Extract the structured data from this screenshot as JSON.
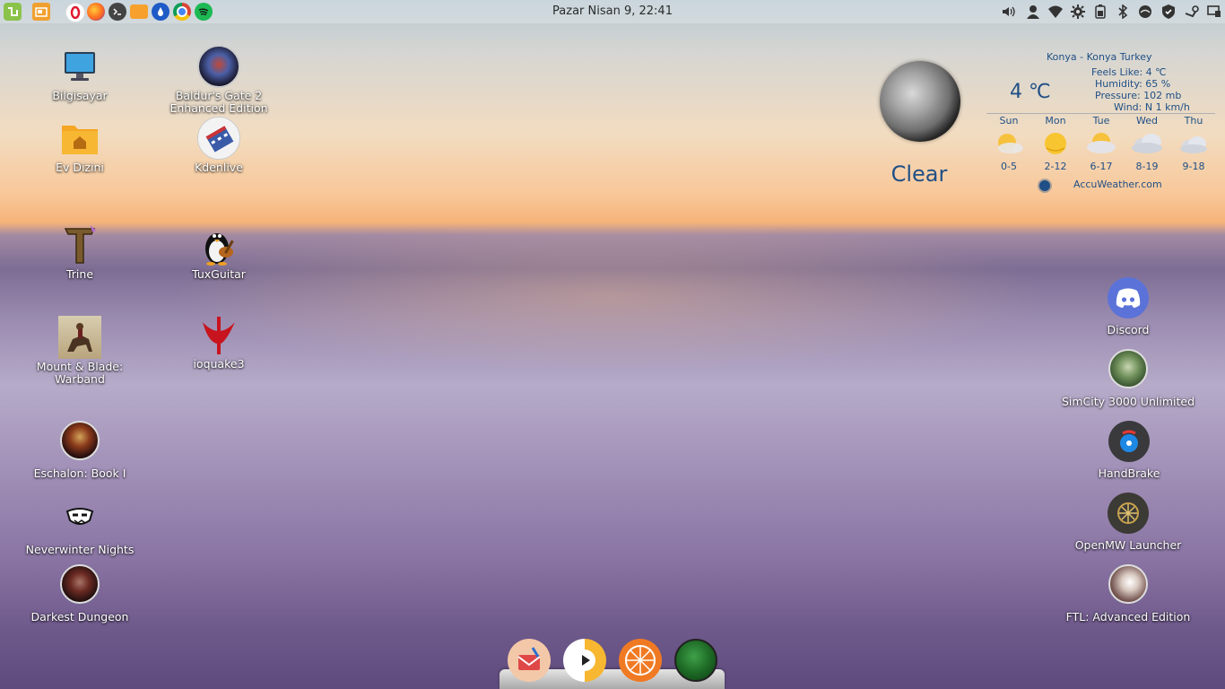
{
  "top_panel": {
    "clock": "Pazar Nisan  9, 22:41",
    "launchers": [
      "menu-icon",
      "files-app-icon",
      "opera-icon",
      "firefox-icon",
      "terminal-icon",
      "folder-icon",
      "water-drop-icon",
      "chrome-icon",
      "spotify-icon"
    ],
    "tray": [
      "volume-icon",
      "user-icon",
      "wifi-icon",
      "settings-icon",
      "power-icon",
      "bluetooth-icon",
      "network-icon",
      "shield-icon",
      "steam-icon",
      "display-icon"
    ]
  },
  "desktop_icons": {
    "bilgisayar": "Bilgisayar",
    "baldurs_gate": "Baldur's Gate 2\nEnhanced Edition",
    "ev_dizini": "Ev Dizini",
    "kdenlive": "Kdenlive",
    "trine": "Trine",
    "tuxguitar": "TuxGuitar",
    "mount_blade": "Mount & Blade:\nWarband",
    "ioquake3": "ioquake3",
    "eschalon": "Eschalon: Book I",
    "neverwinter": "Neverwinter Nights",
    "darkest": "Darkest Dungeon",
    "discord": "Discord",
    "simcity": "SimCity 3000 Unlimited",
    "handbrake": "HandBrake",
    "openmw": "OpenMW Launcher",
    "ftl": "FTL: Advanced Edition"
  },
  "weather": {
    "location": "Konya - Konya Turkey",
    "temperature": "4 ℃",
    "condition": "Clear",
    "feels_like": "Feels Like: 4 ℃",
    "humidity": "Humidity: 65 %",
    "pressure": "Pressure: 102 mb",
    "wind": "Wind: N 1 km/h",
    "forecast": [
      {
        "day": "Sun",
        "range": "0-5",
        "icon": "sun-cloud-icon"
      },
      {
        "day": "Mon",
        "range": "2-12",
        "icon": "sun-icon"
      },
      {
        "day": "Tue",
        "range": "6-17",
        "icon": "sun-cloud-icon"
      },
      {
        "day": "Wed",
        "range": "8-19",
        "icon": "cloud-icon"
      },
      {
        "day": "Thu",
        "range": "9-18",
        "icon": "cloud-icon"
      }
    ],
    "provider": "AccuWeather.com",
    "colors": {
      "text": "#1f4f86"
    }
  },
  "dock": {
    "items": [
      "mail-app-icon",
      "media-player-icon",
      "citrus-app-icon",
      "green-orb-icon"
    ]
  }
}
